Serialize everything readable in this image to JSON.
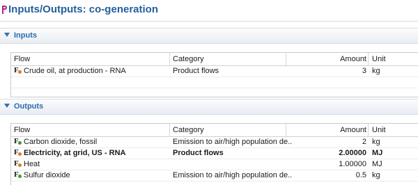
{
  "title": "Inputs/Outputs: co-generation",
  "inputs": {
    "label": "Inputs",
    "headers": {
      "flow": "Flow",
      "category": "Category",
      "amount": "Amount",
      "unit": "Unit"
    },
    "rows": [
      {
        "flow": "Crude oil, at production - RNA",
        "category": "Product flows",
        "amount": "3",
        "unit": "kg",
        "bold": false,
        "icon_color": "#e07a1f"
      }
    ]
  },
  "outputs": {
    "label": "Outputs",
    "headers": {
      "flow": "Flow",
      "category": "Category",
      "amount": "Amount",
      "unit": "Unit"
    },
    "rows": [
      {
        "flow": "Carbon dioxide, fossil",
        "category": "Emission to air/high population de...",
        "amount": "2",
        "unit": "kg",
        "bold": false,
        "icon_color": "#3a9a3a"
      },
      {
        "flow": "Electricity, at grid, US - RNA",
        "category": "Product flows",
        "amount": "2.00000",
        "unit": "MJ",
        "bold": true,
        "icon_color": "#e07a1f"
      },
      {
        "flow": "Heat",
        "category": "",
        "amount": "1.00000",
        "unit": "MJ",
        "bold": false,
        "icon_color": "#e07a1f"
      },
      {
        "flow": "Sulfur dioxide",
        "category": "Emission to air/high population de...",
        "amount": "0.5",
        "unit": "kg",
        "bold": false,
        "icon_color": "#3a9a3a"
      }
    ]
  },
  "colors": {
    "title": "#255f9c",
    "section": "#2a6bb0",
    "title_icon": "#b0208f"
  },
  "icons": {
    "title": "process-icon",
    "flow": "flow-icon",
    "unit": "unit-group-icon"
  }
}
